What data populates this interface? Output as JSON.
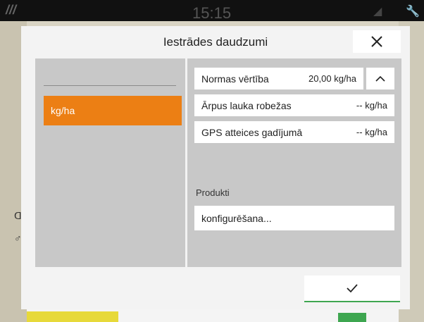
{
  "status_bar": {
    "time": "15:15"
  },
  "dialog": {
    "title": "Iestrādes daudzumi",
    "units": [
      {
        "label": "kg/ha",
        "selected": true
      }
    ],
    "rows": [
      {
        "label": "Normas vērtība",
        "value": "20,00 kg/ha"
      },
      {
        "label": "Ārpus lauka robežas",
        "value": "-- kg/ha"
      },
      {
        "label": "GPS atteices gadījumā",
        "value": "-- kg/ha"
      }
    ],
    "products_label": "Produkti",
    "configure_label": "konfigurēšana...",
    "colors": {
      "accent": "#ec7f14",
      "confirm": "#3ea650"
    }
  }
}
